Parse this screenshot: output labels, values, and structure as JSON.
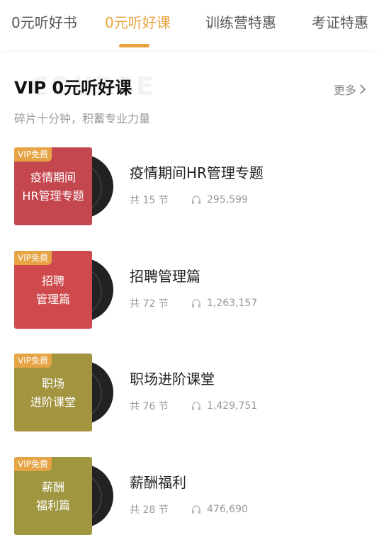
{
  "tabs": [
    {
      "label": "0元听好书",
      "active": false
    },
    {
      "label": "0元听好课",
      "active": true
    },
    {
      "label": "训练营特惠",
      "active": false
    },
    {
      "label": "考证特惠",
      "active": false
    }
  ],
  "accent_color": "#e8a33d",
  "section": {
    "watermark": "COURSE",
    "title": "VIP 0元听好课",
    "subtitle": "碎片十分钟，积蓄专业力量",
    "more_label": "更多",
    "more_icon": "chevron-right-icon"
  },
  "courses": [
    {
      "badge": "VIP免费",
      "cover_text": "疫情期间\nHR管理专题",
      "title": "疫情期间HR管理专题",
      "lessons": "共 15 节",
      "listens": "295,599",
      "cover_color": "#c4464f"
    },
    {
      "badge": "VIP免费",
      "cover_text": "招聘\n管理篇",
      "title": "招聘管理篇",
      "lessons": "共 72 节",
      "listens": "1,263,157",
      "cover_color": "#cf4a4c"
    },
    {
      "badge": "VIP免费",
      "cover_text": "职场\n进阶课堂",
      "title": "职场进阶课堂",
      "lessons": "共 76 节",
      "listens": "1,429,751",
      "cover_color": "#a39440"
    },
    {
      "badge": "VIP免费",
      "cover_text": "薪酬\n福利篇",
      "title": "薪酬福利",
      "lessons": "共 28 节",
      "listens": "476,690",
      "cover_color": "#9f963f"
    }
  ]
}
